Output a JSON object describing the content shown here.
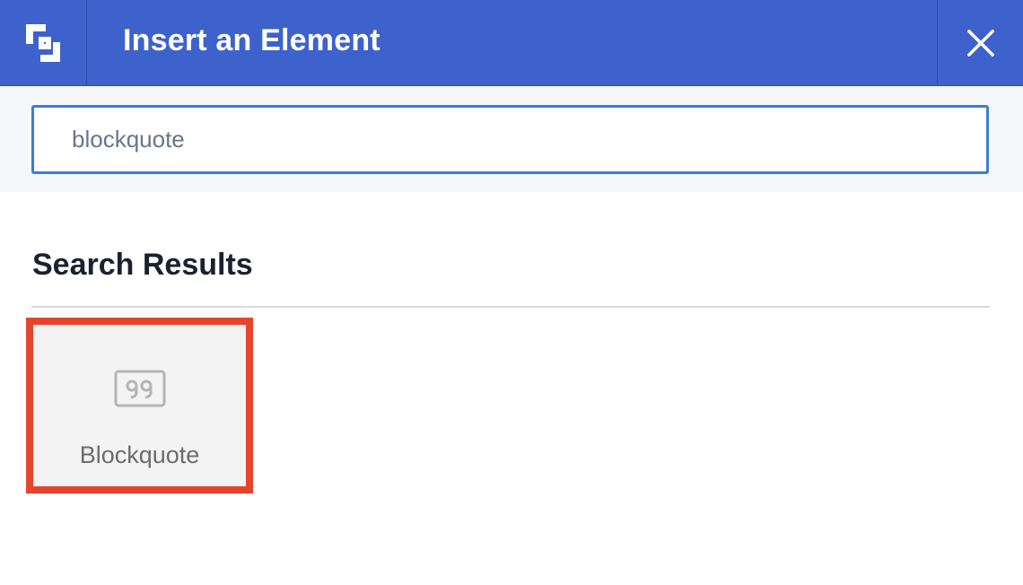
{
  "header": {
    "logo_icon": "brand-logo-icon",
    "title": "Insert an Element",
    "close_icon": "close-icon",
    "background": "#3e62cc"
  },
  "search": {
    "value": "blockquote",
    "border_color": "#3e7bd6"
  },
  "results": {
    "heading": "Search Results",
    "items": [
      {
        "label": "Blockquote",
        "icon": "quote-icon",
        "highlighted": true,
        "highlight_color": "#e5442d"
      }
    ]
  }
}
